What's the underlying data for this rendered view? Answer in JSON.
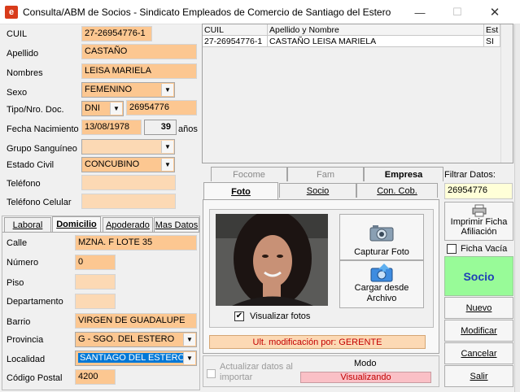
{
  "window": {
    "title": "Consulta/ABM de Socios - Sindicato Empleados de Comercio de Santiago del Estero",
    "icon_letter": "e",
    "minimize": "—",
    "maximize": "☐",
    "close": "✕"
  },
  "form": {
    "cuil": {
      "label": "CUIL",
      "value": "27-26954776-1"
    },
    "apellido": {
      "label": "Apellido",
      "value": "CASTAÑO"
    },
    "nombres": {
      "label": "Nombres",
      "value": "LEISA MARIELA"
    },
    "sexo": {
      "label": "Sexo",
      "value": "FEMENINO"
    },
    "tipo_doc": {
      "label": "Tipo/Nro. Doc.",
      "type_value": "DNI",
      "number_value": "26954776"
    },
    "fecha_nac": {
      "label": "Fecha Nacimiento",
      "value": "13/08/1978",
      "age": "39",
      "age_unit": "años"
    },
    "grupo": {
      "label": "Grupo Sanguíneo",
      "value": ""
    },
    "estado_civil": {
      "label": "Estado Civil",
      "value": "CONCUBINO"
    },
    "telefono": {
      "label": "Teléfono",
      "value": ""
    },
    "telefono_celular": {
      "label": "Teléfono Celular",
      "value": ""
    }
  },
  "lower_tabs": [
    "Laboral",
    "Domicilio",
    "Apoderado",
    "Mas Datos"
  ],
  "domicilio": {
    "calle": {
      "label": "Calle",
      "value": "MZNA. F LOTE 35"
    },
    "numero": {
      "label": "Número",
      "value": "0"
    },
    "piso": {
      "label": "Piso",
      "value": ""
    },
    "departamento": {
      "label": "Departamento",
      "value": ""
    },
    "barrio": {
      "label": "Barrio",
      "value": "VIRGEN DE GUADALUPE"
    },
    "provincia": {
      "label": "Provincia",
      "value": "G - SGO. DEL ESTERO"
    },
    "localidad": {
      "label": "Localidad",
      "value": "SANTIAGO DEL ESTERO"
    },
    "codigo_postal": {
      "label": "Código Postal",
      "value": "4200"
    }
  },
  "grid": {
    "headers": [
      "CUIL",
      "Apellido y Nombre",
      "Est"
    ],
    "rows": [
      [
        "27-26954776-1",
        "CASTAÑO LEISA MARIELA",
        "SI"
      ]
    ]
  },
  "photo_tabs": {
    "row1": [
      "Focome",
      "Fam",
      "Empresa"
    ],
    "row2": [
      "Foto",
      "Socio",
      "Con. Cob."
    ]
  },
  "photo": {
    "capturar": "Capturar Foto",
    "cargar": "Cargar desde Archivo",
    "visualizar_label": "Visualizar fotos",
    "visualizar_checked": "✔",
    "ult_mod": "Ult. modificación por: GERENTE"
  },
  "bottom": {
    "actualizar_label": "Actualizar datos al importar",
    "modo_label": "Modo",
    "modo_value": "Visualizando"
  },
  "right": {
    "filtrar_label": "Filtrar Datos:",
    "filtrar_value": "26954776",
    "imprimir": "Imprimir Ficha Afiliación",
    "ficha_vacia": "Ficha Vacía",
    "socio": "Socio",
    "nuevo": "Nuevo",
    "modificar": "Modificar",
    "cancelar": "Cancelar",
    "salir": "Salir"
  },
  "colors": {
    "field_bg": "#fcc791",
    "socio_bg": "#98fb98",
    "status_bg": "#fac0c6",
    "selection": "#0078d7"
  }
}
